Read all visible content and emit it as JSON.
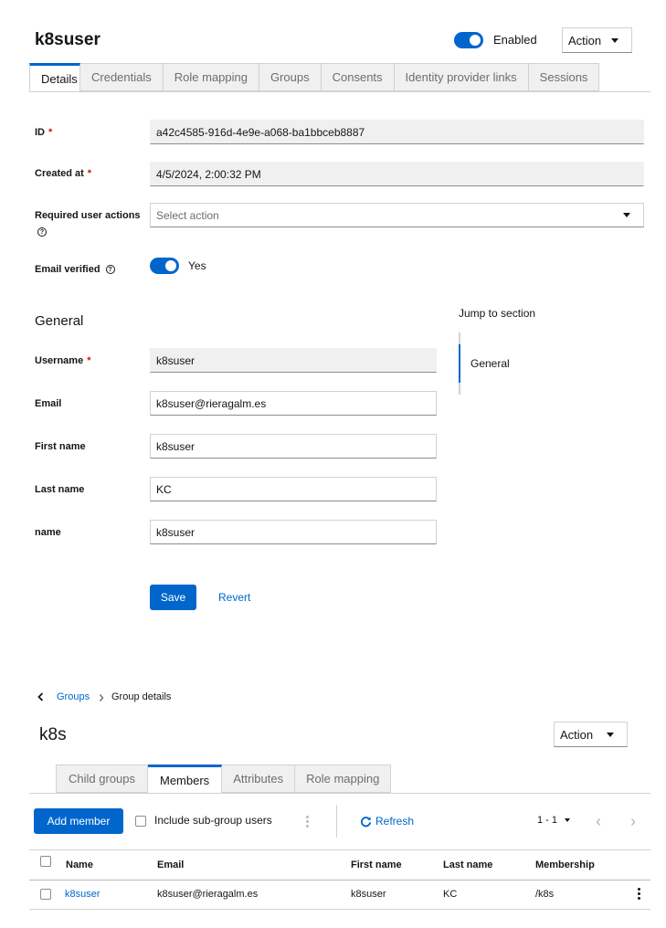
{
  "user": {
    "title": "k8suser",
    "enabled_label": "Enabled",
    "action_label": "Action",
    "tabs": [
      "Details",
      "Credentials",
      "Role mapping",
      "Groups",
      "Consents",
      "Identity provider links",
      "Sessions"
    ],
    "fields": {
      "id_label": "ID",
      "id_value": "a42c4585-916d-4e9e-a068-ba1bbceb8887",
      "created_label": "Created at",
      "created_value": "4/5/2024, 2:00:32 PM",
      "required_actions_label": "Required user actions",
      "required_actions_placeholder": "Select action",
      "email_verified_label": "Email verified",
      "email_verified_value": "Yes"
    },
    "general": {
      "title": "General",
      "username_label": "Username",
      "username_value": "k8suser",
      "email_label": "Email",
      "email_value": "k8suser@rieragalm.es",
      "first_name_label": "First name",
      "first_name_value": "k8suser",
      "last_name_label": "Last name",
      "last_name_value": "KC",
      "name_label": "name",
      "name_value": "k8suser"
    },
    "save_label": "Save",
    "revert_label": "Revert",
    "jump": {
      "title": "Jump to section",
      "item": "General"
    }
  },
  "group": {
    "breadcrumb": {
      "link": "Groups",
      "current": "Group details"
    },
    "title": "k8s",
    "action_label": "Action",
    "tabs": [
      "Child groups",
      "Members",
      "Attributes",
      "Role mapping"
    ],
    "toolbar": {
      "add_member": "Add member",
      "include_subgroup": "Include sub-group users",
      "refresh": "Refresh",
      "pagination": "1 - 1"
    },
    "table": {
      "headers": [
        "Name",
        "Email",
        "First name",
        "Last name",
        "Membership"
      ],
      "rows": [
        [
          "k8suser",
          "k8suser@rieragalm.es",
          "k8suser",
          "KC",
          "/k8s"
        ]
      ]
    }
  },
  "colors": {
    "primary": "#0066cc",
    "required": "#c9190b"
  },
  "icons": [
    "help-icon",
    "caret-down-icon",
    "chevron-left-icon",
    "chevron-right-icon",
    "refresh-icon",
    "kebab-icon"
  ]
}
